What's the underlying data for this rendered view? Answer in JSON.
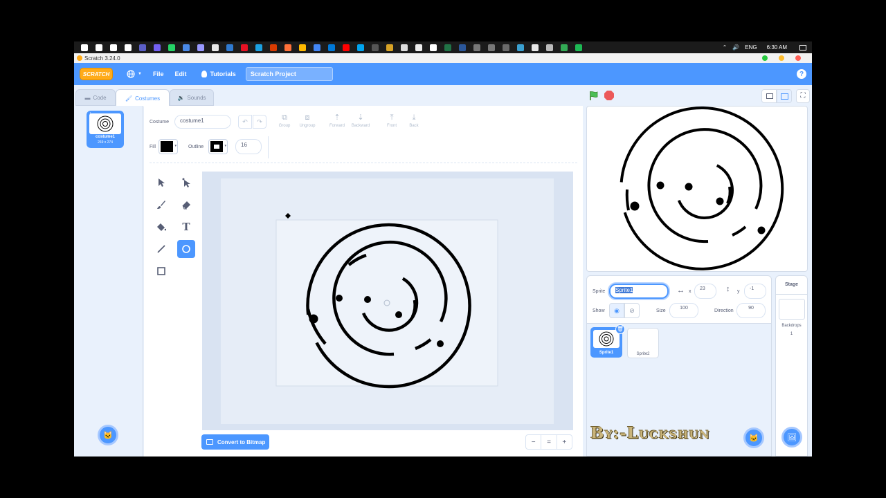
{
  "taskbar": {
    "language": "ENG",
    "time": "6:30 AM",
    "app_icon_colors": [
      "#ffffff",
      "#ffffff",
      "#ffffff",
      "#ffffff",
      "#5b5fc7",
      "#7360f2",
      "#25d366",
      "#4a8ae8",
      "#9999ff",
      "#e8e8e8",
      "#2f7ad1",
      "#e81123",
      "#1ba1e2",
      "#d83b01",
      "#ff7139",
      "#ffb900",
      "#4285f4",
      "#0078d7",
      "#ff0000",
      "#00a4ef",
      "#555555",
      "#d8a326",
      "#dddddd",
      "#eeeeee",
      "#ffffff",
      "#217346",
      "#2b579a",
      "#777777",
      "#777777",
      "#6a6a6a",
      "#3aa0d0",
      "#e8e8e8",
      "#bbbbbb",
      "#33aa55",
      "#1db954"
    ]
  },
  "window": {
    "title": "Scratch 3.24.0"
  },
  "menubar": {
    "logo": "SCRATCH",
    "file": "File",
    "edit": "Edit",
    "tutorials": "Tutorials",
    "project_title": "Scratch Project",
    "help": "?"
  },
  "tabs": {
    "code": "Code",
    "costumes": "Costumes",
    "sounds": "Sounds"
  },
  "costume_list": {
    "index": "1",
    "name": "costume1",
    "size": "269 x 274"
  },
  "paint": {
    "costume_label": "Costume",
    "costume_name": "costume1",
    "group": "Group",
    "ungroup": "Ungroup",
    "forward": "Forward",
    "backward": "Backward",
    "front": "Front",
    "back": "Back",
    "fill_label": "Fill",
    "outline_label": "Outline",
    "outline_width": "16",
    "convert": "Convert to Bitmap",
    "zoom_out": "−",
    "zoom_reset": "=",
    "zoom_in": "+"
  },
  "sprite_info": {
    "sprite_label": "Sprite",
    "sprite_name": "Sprite1",
    "x_label": "x",
    "x": "23",
    "y_label": "y",
    "y": "-1",
    "show_label": "Show",
    "size_label": "Size",
    "size": "100",
    "direction_label": "Direction",
    "direction": "90"
  },
  "sprites": [
    "Sprite1",
    "Sprite2"
  ],
  "stage_panel": {
    "title": "Stage",
    "backdrops_label": "Backdrops",
    "backdrops_count": "1"
  },
  "watermark": "By:-Luckshun"
}
